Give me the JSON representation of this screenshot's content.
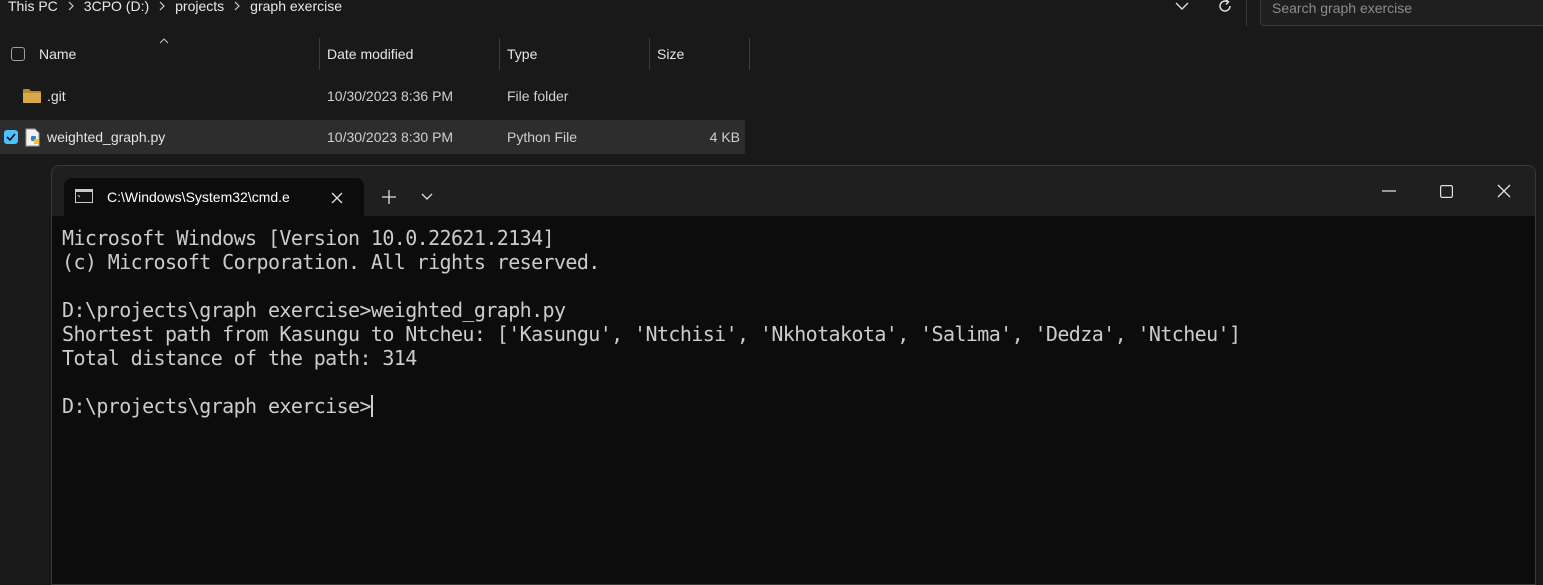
{
  "explorer": {
    "breadcrumbs": [
      "This PC",
      "3CPO (D:)",
      "projects",
      "graph exercise"
    ],
    "search_placeholder": "Search graph exercise",
    "columns": {
      "name": "Name",
      "date_modified": "Date modified",
      "type": "Type",
      "size": "Size"
    },
    "files": [
      {
        "name": ".git",
        "date": "10/30/2023 8:36 PM",
        "type": "File folder",
        "size": "",
        "icon": "folder-icon",
        "selected": false
      },
      {
        "name": "weighted_graph.py",
        "date": "10/30/2023 8:30 PM",
        "type": "Python File",
        "size": "4 KB",
        "icon": "python-file-icon",
        "selected": true
      }
    ]
  },
  "terminal": {
    "tab_title": "C:\\Windows\\System32\\cmd.e",
    "lines": [
      "Microsoft Windows [Version 10.0.22621.2134]",
      "(c) Microsoft Corporation. All rights reserved.",
      "",
      "D:\\projects\\graph exercise>weighted_graph.py",
      "Shortest path from Kasungu to Ntcheu: ['Kasungu', 'Ntchisi', 'Nkhotakota', 'Salima', 'Dedza', 'Ntcheu']",
      "Total distance of the path: 314",
      ""
    ],
    "prompt": "D:\\projects\\graph exercise>"
  },
  "colors": {
    "accent": "#4cc2ff",
    "folder": "#d8a94a",
    "terminal_bg": "#0c0c0c",
    "terminal_text": "#cccccc"
  }
}
